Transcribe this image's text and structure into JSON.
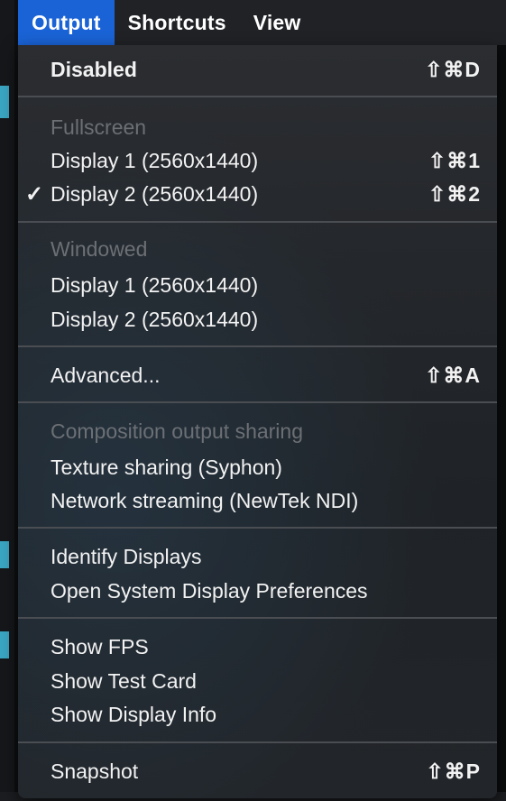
{
  "menubar": {
    "items": [
      {
        "label": "Output",
        "active": true
      },
      {
        "label": "Shortcuts",
        "active": false
      },
      {
        "label": "View",
        "active": false
      }
    ]
  },
  "menu": {
    "disabled": {
      "label": "Disabled",
      "shortcut": "⇧⌘D"
    },
    "fullscreen": {
      "header": "Fullscreen",
      "display1": {
        "label": "Display 1 (2560x1440)",
        "shortcut": "⇧⌘1"
      },
      "display2": {
        "label": "Display 2 (2560x1440)",
        "shortcut": "⇧⌘2",
        "check": "✓"
      }
    },
    "windowed": {
      "header": "Windowed",
      "display1": {
        "label": "Display 1 (2560x1440)"
      },
      "display2": {
        "label": "Display 2 (2560x1440)"
      }
    },
    "advanced": {
      "label": "Advanced...",
      "shortcut": "⇧⌘A"
    },
    "sharing": {
      "header": "Composition output sharing",
      "texture": {
        "label": "Texture sharing (Syphon)"
      },
      "network": {
        "label": "Network streaming (NewTek NDI)"
      }
    },
    "displays": {
      "identify": {
        "label": "Identify Displays"
      },
      "open_prefs": {
        "label": "Open System Display Preferences"
      }
    },
    "show": {
      "fps": {
        "label": "Show FPS"
      },
      "test_card": {
        "label": "Show Test Card"
      },
      "display_info": {
        "label": "Show Display Info"
      }
    },
    "snapshot": {
      "label": "Snapshot",
      "shortcut": "⇧⌘P"
    }
  },
  "colors": {
    "accent": "#1a63d6",
    "menu_bg": "#24272b",
    "disabled_text": "#6c7075"
  }
}
